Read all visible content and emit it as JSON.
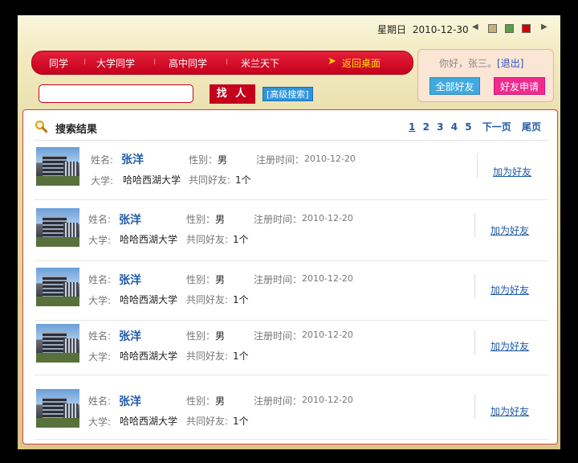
{
  "header": {
    "weekday": "星期日",
    "date": "2010-12-30",
    "prev_arrow": "◀",
    "next_arrow": "▶",
    "theme_colors": [
      "#c8b07a",
      "#5b9e48",
      "#d40000"
    ]
  },
  "nav": {
    "items": [
      {
        "label": "同学"
      },
      {
        "label": "大学同学"
      },
      {
        "label": "高中同学"
      },
      {
        "label": "米兰天下"
      }
    ],
    "separator": "⁞",
    "home_label": "返回桌面",
    "home_icon": "➤"
  },
  "search": {
    "value": "",
    "button_label": "找 人",
    "advanced_label": "[高级搜索]"
  },
  "user_panel": {
    "greeting": "你好，张三。",
    "logout_label": "[退出]",
    "all_friends_label": "全部好友",
    "friend_request_label": "好友申请"
  },
  "results": {
    "title": "搜索结果",
    "pages": [
      "1",
      "2",
      "3",
      "4",
      "5"
    ],
    "current_page": "1",
    "next_label": "下一页",
    "last_label": "尾页",
    "labels": {
      "name": "姓名:",
      "gender": "性别：",
      "register_time": "注册时间：",
      "university": "大学:",
      "mutual_friends": "共同好友:",
      "add_friend": "加为好友"
    },
    "rows": [
      {
        "name": "张洋",
        "gender": "男",
        "register_time": "2010-12-20",
        "university": "哈哈西湖大学",
        "mutual_friends": "1个"
      },
      {
        "name": "张洋",
        "gender": "男",
        "register_time": "2010-12-20",
        "university": "哈哈西湖大学",
        "mutual_friends": "1个"
      },
      {
        "name": "张洋",
        "gender": "男",
        "register_time": "2010-12-20",
        "university": "哈哈西湖大学",
        "mutual_friends": "1个"
      },
      {
        "name": "张洋",
        "gender": "男",
        "register_time": "2010-12-20",
        "university": "哈哈西湖大学",
        "mutual_friends": "1个"
      },
      {
        "name": "张洋",
        "gender": "男",
        "register_time": "2010-12-20",
        "university": "哈哈西湖大学",
        "mutual_friends": "1个"
      }
    ]
  }
}
